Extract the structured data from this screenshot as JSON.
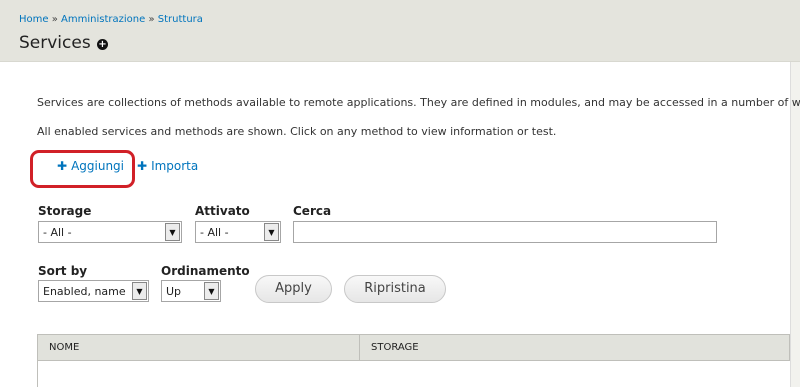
{
  "breadcrumb": {
    "items": [
      "Home",
      "Amministrazione",
      "Struttura"
    ],
    "separator": "»"
  },
  "page": {
    "title": "Services",
    "shortcut_icon": "plus-circle-icon"
  },
  "description": {
    "line1": "Services are collections of methods available to remote applications. They are defined in modules, and may be accessed in a number of w",
    "line2": "All enabled services and methods are shown. Click on any method to view information or test."
  },
  "actions": {
    "add_label": "Aggiungi",
    "import_label": "Importa",
    "icon": "plus-icon"
  },
  "filters": {
    "storage": {
      "label": "Storage",
      "value": "- All -"
    },
    "enabled": {
      "label": "Attivato",
      "value": "- All -"
    },
    "search": {
      "label": "Cerca",
      "value": ""
    },
    "sort_by": {
      "label": "Sort by",
      "value": "Enabled, name"
    },
    "order": {
      "label": "Ordinamento",
      "value": "Up"
    },
    "apply_label": "Apply",
    "reset_label": "Ripristina"
  },
  "table": {
    "columns": [
      "NOME",
      "STORAGE"
    ]
  },
  "colors": {
    "link": "#0074bd",
    "header_bg": "#e4e4dd",
    "highlight": "#d12027"
  }
}
